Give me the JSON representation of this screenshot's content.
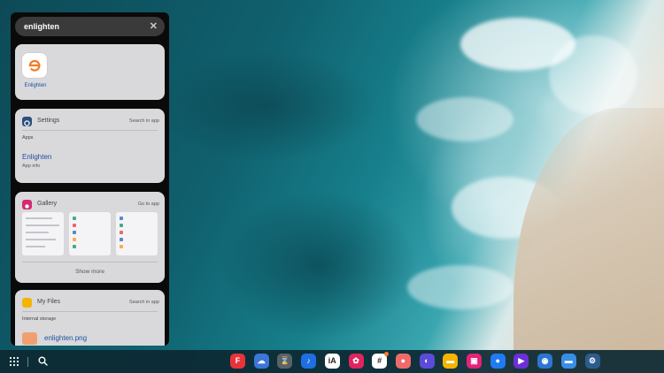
{
  "search": {
    "query": "enlighten"
  },
  "top_result": {
    "app_name": "Enlighten"
  },
  "settings_card": {
    "title": "Settings",
    "action": "Search in app",
    "section": "Apps",
    "result_title": "Enlighten",
    "result_sub": "App info"
  },
  "gallery_card": {
    "title": "Gallery",
    "action": "Go to app",
    "show_more": "Show more"
  },
  "files_card": {
    "title": "My Files",
    "action": "Search in app",
    "section": "Internal storage",
    "file_name": "enlighten.png"
  },
  "taskbar": {
    "apps": [
      {
        "icon": "flipboard-icon",
        "color": "#e8333a",
        "glyph": "F"
      },
      {
        "icon": "cloud-icon",
        "color": "#3b76d8",
        "glyph": "☁"
      },
      {
        "icon": "hourglass-icon",
        "color": "#5a6168",
        "glyph": "⌛"
      },
      {
        "icon": "tiktok-icon",
        "color": "#1e6fe0",
        "glyph": "♪"
      },
      {
        "icon": "ia-writer-icon",
        "color": "#ffffff",
        "glyph": "iA"
      },
      {
        "icon": "flower-icon",
        "color": "#e0245e",
        "glyph": "✿"
      },
      {
        "icon": "slack-icon",
        "color": "#ffffff",
        "glyph": "#"
      },
      {
        "icon": "asana-icon",
        "color": "#f06a6a",
        "glyph": "●"
      },
      {
        "icon": "samsung-internet-icon",
        "color": "#5b4bd8",
        "glyph": "◐"
      },
      {
        "icon": "folder-icon",
        "color": "#f4b400",
        "glyph": "▬"
      },
      {
        "icon": "gallery-icon",
        "color": "#e4227a",
        "glyph": "▣"
      },
      {
        "icon": "messages-icon",
        "color": "#1f7bf2",
        "glyph": "●"
      },
      {
        "icon": "play-icon",
        "color": "#6b2fd6",
        "glyph": "▶"
      },
      {
        "icon": "podcast-icon",
        "color": "#2b76d0",
        "glyph": "◉"
      },
      {
        "icon": "my-files-icon",
        "color": "#3a8ee6",
        "glyph": "▬"
      },
      {
        "icon": "settings-icon",
        "color": "#2c5c8c",
        "glyph": "⚙"
      }
    ]
  },
  "colors": {
    "accent_link": "#1b4f9c",
    "enlighten_orange": "#f47a20"
  }
}
